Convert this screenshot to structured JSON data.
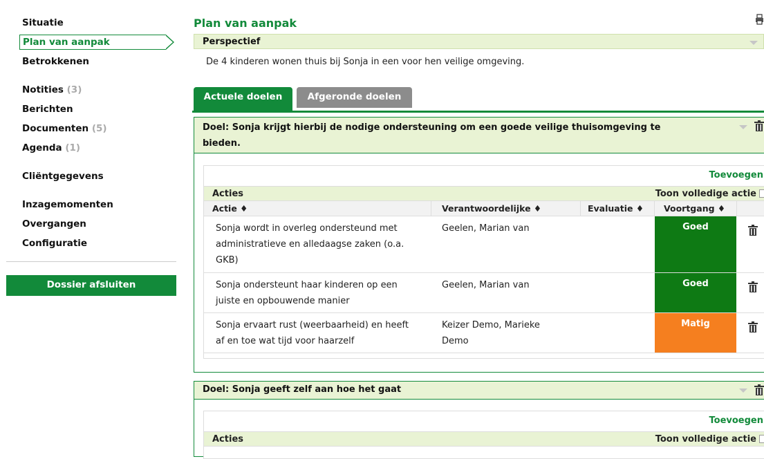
{
  "sidebar": {
    "items": [
      {
        "label": "Situatie",
        "count": ""
      },
      {
        "label": "Plan van aanpak",
        "count": ""
      },
      {
        "label": "Betrokkenen",
        "count": ""
      },
      {
        "label": "Notities",
        "count": "(3)"
      },
      {
        "label": "Berichten",
        "count": ""
      },
      {
        "label": "Documenten",
        "count": "(5)"
      },
      {
        "label": "Agenda",
        "count": "(1)"
      },
      {
        "label": "Cliëntgegevens",
        "count": ""
      },
      {
        "label": "Inzagemomenten",
        "count": ""
      },
      {
        "label": "Overgangen",
        "count": ""
      },
      {
        "label": "Configuratie",
        "count": ""
      }
    ],
    "active_index": 1,
    "close_button": "Dossier afsluiten"
  },
  "main": {
    "title": "Plan van aanpak",
    "perspective": {
      "label": "Perspectief",
      "text": "De 4 kinderen wonen thuis bij Sonja in een voor hen veilige omgeving."
    },
    "tabs": [
      {
        "label": "Actuele doelen",
        "active": true
      },
      {
        "label": "Afgeronde doelen",
        "active": false
      }
    ],
    "goals": [
      {
        "title_line1": "Doel: Sonja krijgt hierbij de nodige ondersteuning om een goede veilige thuisomgeving te",
        "title_line2": "bieden.",
        "add_label": "Toevoegen",
        "actions_label": "Acties",
        "toggle_label": "Toon volledige actie",
        "columns": [
          "Actie ♦",
          "Verantwoordelijke ♦",
          "Evaluatie ♦",
          "Voortgang ♦"
        ],
        "rows": [
          {
            "actie": [
              "Sonja wordt in overleg ondersteund met",
              "administratieve en alledaagse zaken (o.a.",
              "GKB)"
            ],
            "resp": [
              "Geelen, Marian van"
            ],
            "eval": "",
            "status": "Goed"
          },
          {
            "actie": [
              "Sonja ondersteunt haar kinderen op een",
              "juiste en opbouwende manier"
            ],
            "resp": [
              "Geelen, Marian van"
            ],
            "eval": "",
            "status": "Goed"
          },
          {
            "actie": [
              "Sonja ervaart rust (weerbaarheid) en heeft",
              "af en toe wat tijd voor haarzelf"
            ],
            "resp": [
              "Keizer Demo, Marieke",
              "Demo"
            ],
            "eval": "",
            "status": "Matig"
          }
        ]
      },
      {
        "title_line1": "Doel: Sonja geeft zelf aan hoe het gaat",
        "add_label": "Toevoegen",
        "actions_label": "Acties",
        "toggle_label": "Toon volledige actie"
      }
    ]
  },
  "colors": {
    "brand_green": "#128a3a",
    "header_bg": "#e9f3d4",
    "status_goed": "#0e7a14",
    "status_matig": "#f57f1f",
    "tab_inactive": "#8c8c8c",
    "count_grey": "#aaaaaa"
  },
  "icons": [
    "print-icon",
    "trash-icon",
    "chevron-down-icon",
    "arrow-right-icon"
  ]
}
